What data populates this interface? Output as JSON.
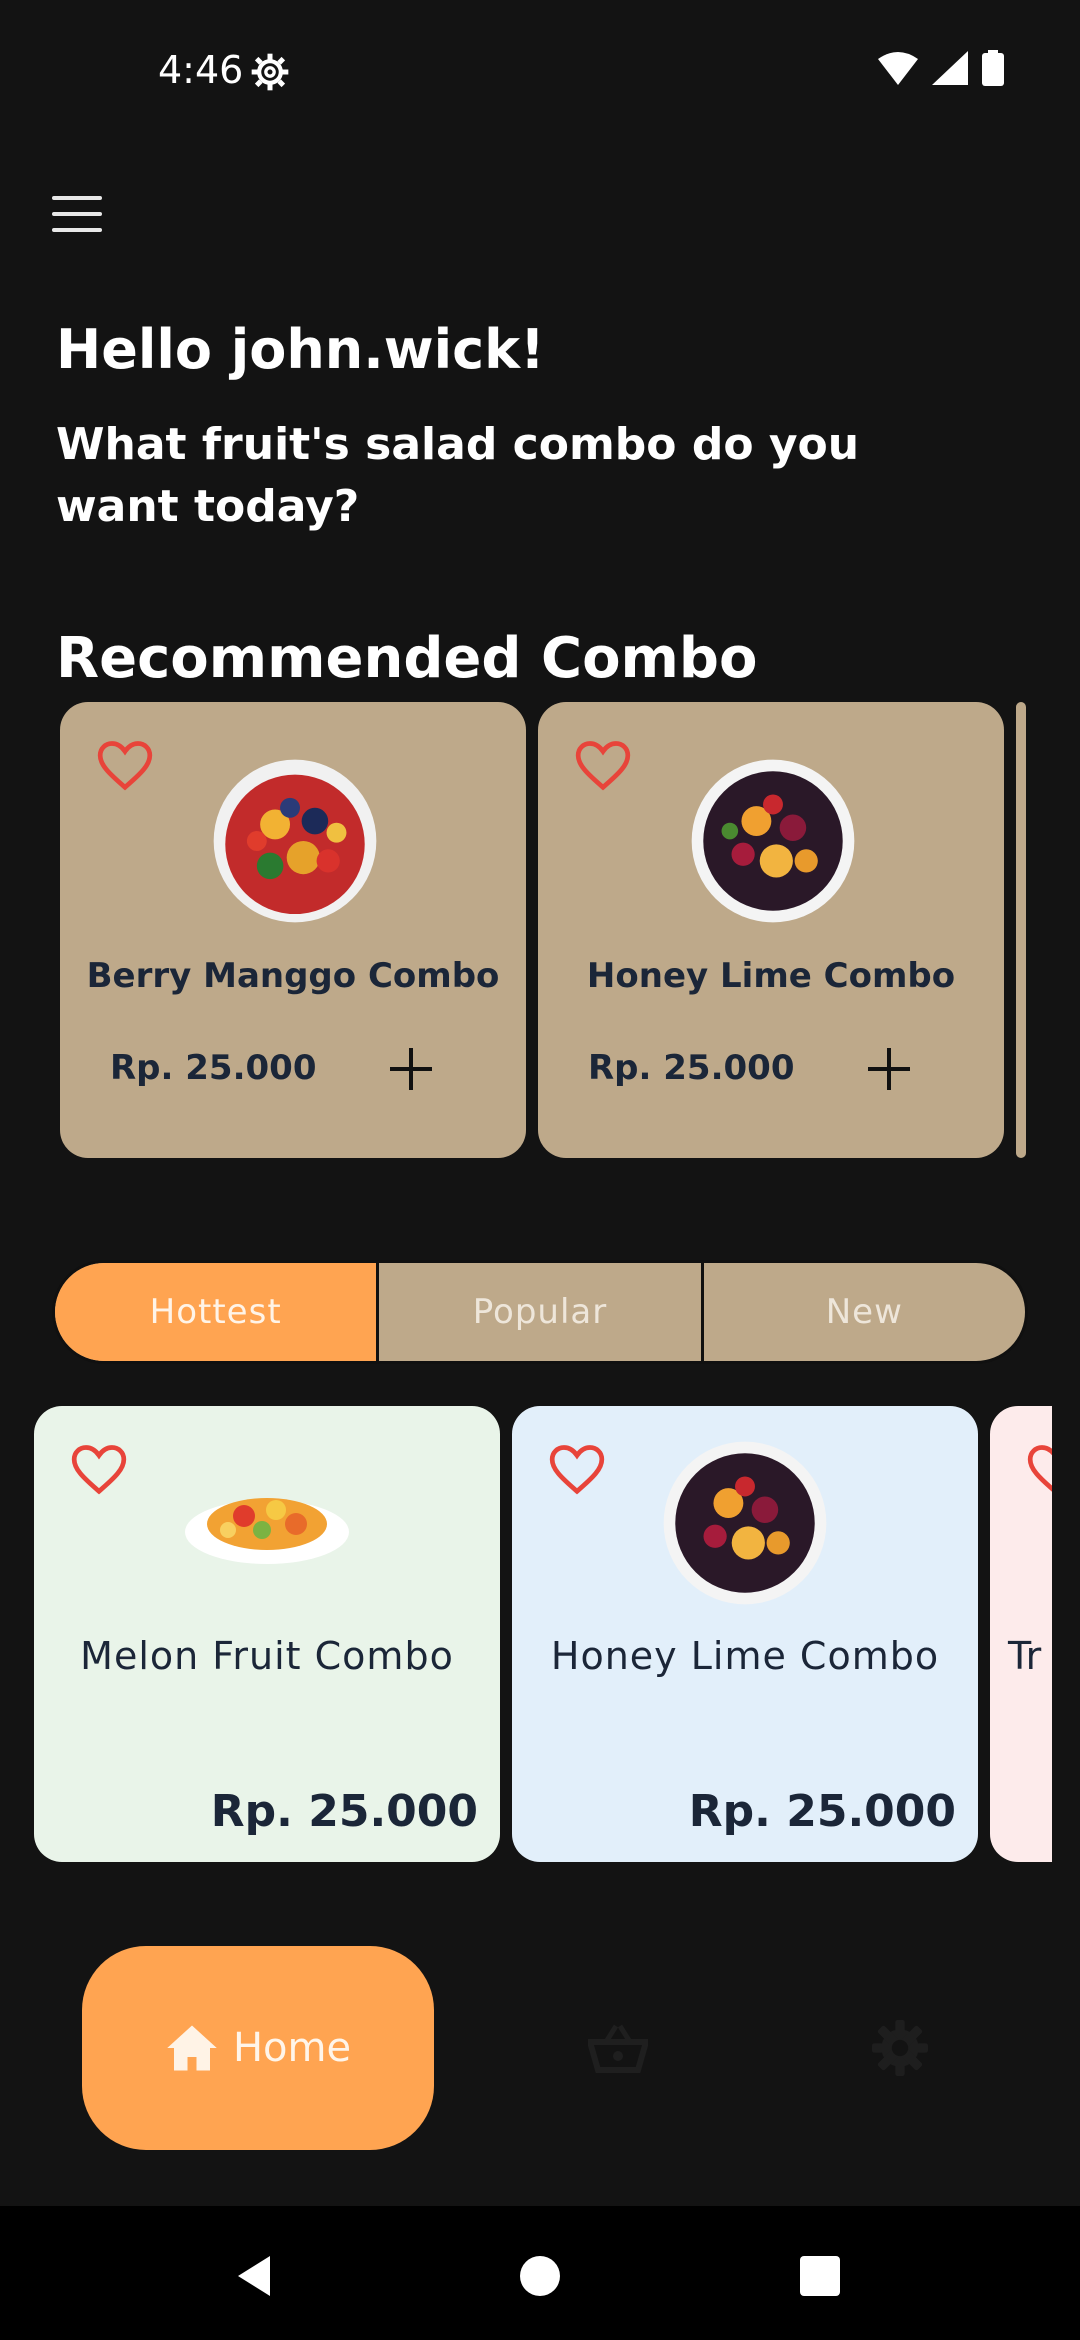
{
  "status_bar": {
    "time": "4:46"
  },
  "header": {
    "greeting": "Hello john.wick!",
    "question": "What fruit's salad combo do you want today?"
  },
  "recommended": {
    "title": "Recommended Combo",
    "items": [
      {
        "name": "Berry Manggo Combo",
        "price": "Rp. 25.000"
      },
      {
        "name": "Honey Lime Combo",
        "price": "Rp. 25.000"
      }
    ]
  },
  "tabs": [
    {
      "label": "Hottest",
      "active": true
    },
    {
      "label": "Popular",
      "active": false
    },
    {
      "label": "New",
      "active": false
    }
  ],
  "products": [
    {
      "name": "Melon Fruit Combo",
      "price": "Rp. 25.000",
      "bg": "#e9f4e9"
    },
    {
      "name": "Honey Lime Combo",
      "price": "Rp. 25.000",
      "bg": "#e2effa"
    },
    {
      "name": "Tr",
      "bg": "#fdebeb"
    }
  ],
  "bottom_nav": {
    "home_label": "Home"
  },
  "colors": {
    "accent": "#ffa451",
    "card": "#bea98a",
    "heart": "#e8443a"
  }
}
